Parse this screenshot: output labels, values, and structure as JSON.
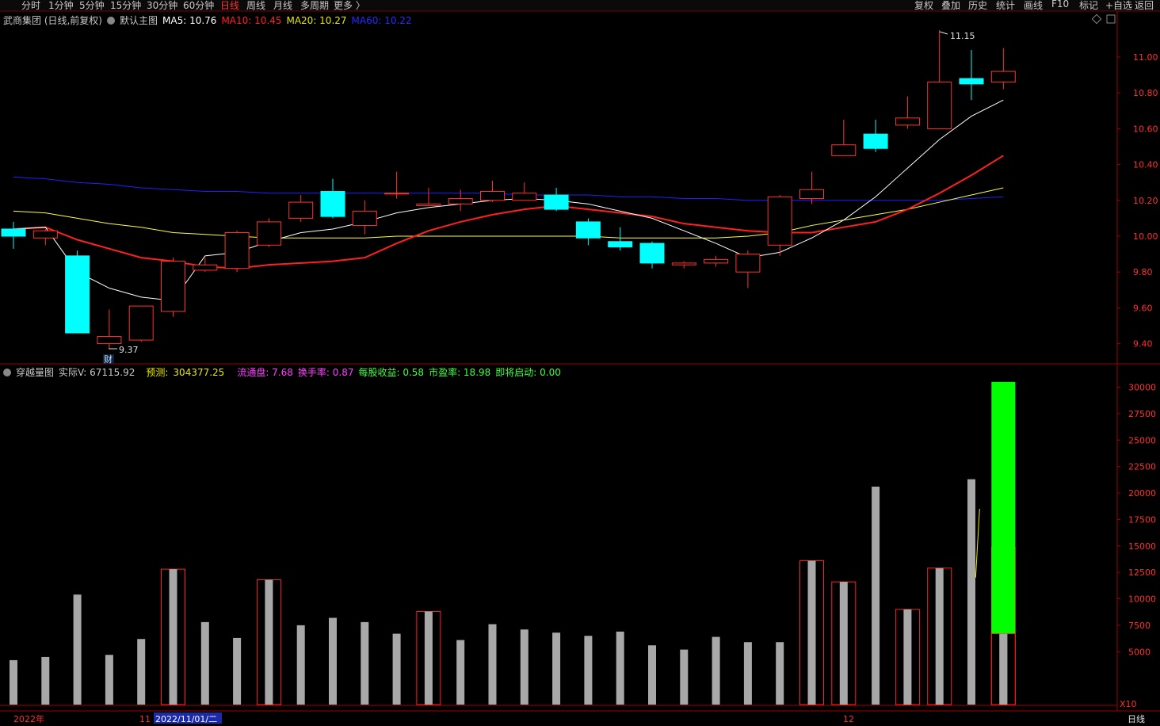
{
  "toolbar": {
    "periods": [
      "分时",
      "1分钟",
      "5分钟",
      "15分钟",
      "30分钟",
      "60分钟",
      "日线",
      "周线",
      "月线",
      "多周期",
      "更多 〉"
    ],
    "active": "日线",
    "right": [
      "复权",
      "叠加",
      "历史",
      "统计",
      "画线",
      "F10",
      "标记",
      "+自选",
      "返回"
    ]
  },
  "header": {
    "stock": "武商集团 (日线,前复权)",
    "main_label": "默认主图",
    "ma5": "MA5: 10.76",
    "ma10": "MA10: 10.45",
    "ma20": "MA20: 10.27",
    "ma60": "MA60: 10.22"
  },
  "vol_header": {
    "name": "穿越量图",
    "actual": "实际V: 67115.92",
    "forecast_label": "预测:",
    "forecast_value": "304377.25",
    "circ": "流通盘: 7.68",
    "turnover": "换手率: 0.87",
    "eps": "每股收益: 0.58",
    "pe": "市盈率: 18.98",
    "start": "即将启动: 0.00"
  },
  "colors": {
    "up": "#ff3232",
    "down": "#00ffff",
    "ma5": "#ffffff",
    "ma10": "#ff2020",
    "ma20": "#ffff40",
    "ma60": "#2020ff",
    "vol_gray": "#a8a8a8",
    "forecast": "#00ff00"
  },
  "chart_data": [
    {
      "type": "candlestick",
      "price_ticks": [
        "9.40",
        "9.60",
        "9.80",
        "10.00",
        "10.20",
        "10.40",
        "10.60",
        "10.80",
        "11.00"
      ],
      "annotations": [
        "11.15",
        "9.37",
        "财"
      ],
      "candles": [
        [
          10.04,
          10.08,
          9.93,
          10.0
        ],
        [
          9.99,
          10.04,
          9.95,
          10.03
        ],
        [
          9.89,
          9.92,
          9.46,
          9.46
        ],
        [
          9.4,
          9.59,
          9.37,
          9.44
        ],
        [
          9.42,
          9.61,
          9.41,
          9.61
        ],
        [
          9.58,
          9.88,
          9.55,
          9.86
        ],
        [
          9.81,
          9.88,
          9.8,
          9.84
        ],
        [
          9.82,
          10.03,
          9.8,
          10.02
        ],
        [
          9.95,
          10.1,
          9.94,
          10.08
        ],
        [
          10.1,
          10.23,
          10.08,
          10.19
        ],
        [
          10.25,
          10.32,
          10.1,
          10.11
        ],
        [
          10.06,
          10.2,
          10.01,
          10.14
        ],
        [
          10.24,
          10.36,
          10.21,
          10.24
        ],
        [
          10.17,
          10.27,
          10.17,
          10.18
        ],
        [
          10.18,
          10.26,
          10.14,
          10.21
        ],
        [
          10.2,
          10.31,
          10.19,
          10.25
        ],
        [
          10.2,
          10.3,
          10.2,
          10.24
        ],
        [
          10.23,
          10.27,
          10.14,
          10.15
        ],
        [
          10.08,
          10.1,
          9.95,
          9.99
        ],
        [
          9.97,
          10.05,
          9.92,
          9.94
        ],
        [
          9.96,
          9.97,
          9.82,
          9.85
        ],
        [
          9.84,
          9.86,
          9.82,
          9.85
        ],
        [
          9.85,
          9.89,
          9.83,
          9.87
        ],
        [
          9.8,
          9.92,
          9.71,
          9.9
        ],
        [
          9.95,
          10.23,
          9.89,
          10.22
        ],
        [
          10.21,
          10.36,
          10.18,
          10.26
        ],
        [
          10.45,
          10.65,
          10.45,
          10.51
        ],
        [
          10.57,
          10.65,
          10.47,
          10.49
        ],
        [
          10.62,
          10.78,
          10.6,
          10.66
        ],
        [
          10.6,
          11.15,
          10.6,
          10.86
        ],
        [
          10.88,
          11.04,
          10.76,
          10.85
        ],
        [
          10.86,
          11.05,
          10.82,
          10.92
        ]
      ],
      "ma5": [
        10.04,
        10.05,
        9.8,
        9.71,
        9.66,
        9.64,
        9.89,
        9.91,
        9.97,
        10.02,
        10.04,
        10.08,
        10.13,
        10.16,
        10.18,
        10.2,
        10.21,
        10.2,
        10.18,
        10.14,
        10.1,
        10.03,
        9.96,
        9.88,
        9.91,
        9.99,
        10.09,
        10.22,
        10.38,
        10.54,
        10.67,
        10.76
      ],
      "ma10": [
        10.04,
        10.05,
        9.98,
        9.93,
        9.88,
        9.86,
        9.83,
        9.82,
        9.84,
        9.85,
        9.86,
        9.88,
        9.96,
        10.03,
        10.08,
        10.12,
        10.15,
        10.17,
        10.15,
        10.13,
        10.11,
        10.07,
        10.05,
        10.03,
        10.02,
        10.02,
        10.05,
        10.08,
        10.15,
        10.24,
        10.34,
        10.45
      ],
      "ma20": [
        10.14,
        10.13,
        10.1,
        10.07,
        10.05,
        10.02,
        10.01,
        10.0,
        9.99,
        9.99,
        9.99,
        9.99,
        10.0,
        10.0,
        10.0,
        10.0,
        10.0,
        10.0,
        10.0,
        9.99,
        9.99,
        9.99,
        9.99,
        10.0,
        10.02,
        10.06,
        10.09,
        10.12,
        10.15,
        10.19,
        10.23,
        10.27
      ],
      "ma60": [
        10.33,
        10.32,
        10.3,
        10.29,
        10.27,
        10.26,
        10.25,
        10.25,
        10.24,
        10.24,
        10.24,
        10.24,
        10.24,
        10.24,
        10.24,
        10.24,
        10.23,
        10.23,
        10.23,
        10.22,
        10.22,
        10.21,
        10.21,
        10.2,
        10.2,
        10.2,
        10.2,
        10.2,
        10.2,
        10.2,
        10.21,
        10.22
      ],
      "volume": [
        4200,
        4500,
        10400,
        4700,
        6200,
        12800,
        7800,
        6300,
        11800,
        7500,
        8200,
        7800,
        6700,
        8800,
        6100,
        7600,
        7100,
        6800,
        6500,
        6900,
        5600,
        5200,
        6400,
        5900,
        5900,
        13600,
        11600,
        20600,
        9000,
        12900,
        21300,
        14900
      ],
      "volume_forecast": 30500,
      "volume_current": 6700,
      "volume_ticks": [
        "5000",
        "7500",
        "10000",
        "12500",
        "15000",
        "17500",
        "20000",
        "22500",
        "25000",
        "27500",
        "30000"
      ],
      "x_labels": [
        "2022年",
        "11",
        "2022/11/01/二",
        "12",
        "日线"
      ],
      "vol_scale": "X10"
    }
  ]
}
